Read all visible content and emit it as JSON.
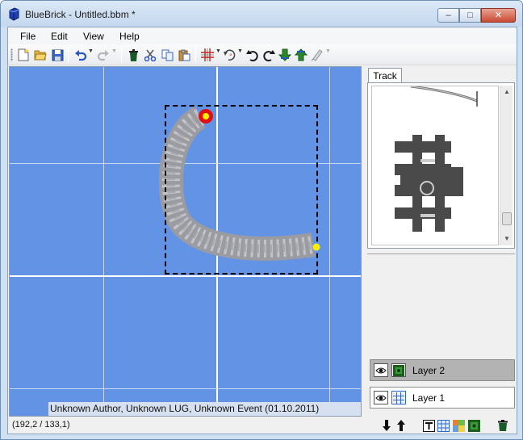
{
  "window": {
    "title": "BlueBrick - Untitled.bbm *",
    "minimize_label": "–",
    "maximize_label": "□",
    "close_label": "✕"
  },
  "menu": [
    "File",
    "Edit",
    "View",
    "Help"
  ],
  "toolbar": {
    "buttons": [
      "new-file-icon",
      "open-folder-icon",
      "save-icon",
      "undo-icon",
      "redo-icon",
      "delete-icon",
      "cut-icon",
      "copy-icon",
      "paste-icon",
      "snap-grid-icon",
      "rotation-step-icon",
      "rotate-ccw-icon",
      "rotate-cw-icon",
      "send-to-back-icon",
      "bring-to-front-icon",
      "paint-icon"
    ]
  },
  "map": {
    "background_color": "#6393e5",
    "info_text": "Unknown Author, Unknown LUG, Unknown Event (01.10.2011)"
  },
  "status": {
    "coordinates": "(192,2 / 133,1)"
  },
  "parts_panel": {
    "tab_label": "Track"
  },
  "layers": [
    {
      "name": "Layer 2",
      "type": "brick",
      "visible": true,
      "selected": true
    },
    {
      "name": "Layer 1",
      "type": "grid",
      "visible": true,
      "selected": false
    }
  ],
  "layer_buttons": [
    "move-layer-down-icon",
    "move-layer-up-icon",
    "new-text-layer-icon",
    "new-grid-layer-icon",
    "new-area-layer-icon",
    "new-brick-layer-icon",
    "delete-layer-icon"
  ]
}
